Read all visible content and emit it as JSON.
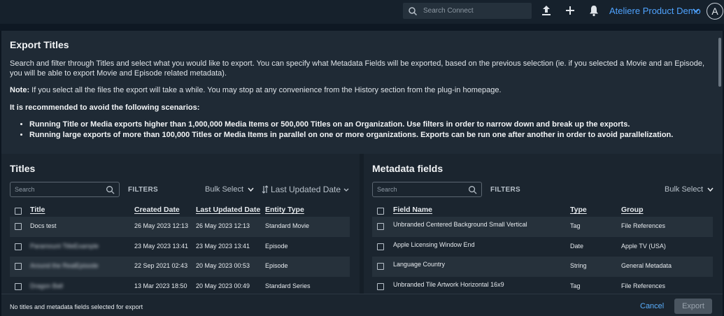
{
  "topbar": {
    "search_placeholder": "Search Connect",
    "org_name": "Ateliere Product Demo",
    "avatar_letter": "A",
    "icons": [
      "upload-icon",
      "plus-icon",
      "bell-icon"
    ]
  },
  "modal": {
    "title": "Export Titles",
    "description": "Search and filter through Titles and select what you would like to export. You can specify what Metadata Fields will be exported, based on the previous selection (ie. if you selected a Movie and an Episode, you will be able to export Movie and Episode related metadata).",
    "note_label": "Note:",
    "note_text": " If you select all the files the export will take a while. You may stop at any convenience from the History section from the plug-in homepage.",
    "recommendation": "It is recommended to avoid the following scenarios:",
    "bullets": [
      "Running Title or Media exports higher than 1,000,000 Media Items or 500,000 Titles on an Organization. Use filters in order to narrow down and break up the exports.",
      "Running large exports of more than 100,000 Titles or Media Items in parallel on one or more organizations. Exports can be run one after another in order to avoid parallelization."
    ]
  },
  "titles_panel": {
    "title": "Titles",
    "search_placeholder": "Search",
    "filters_label": "FILTERS",
    "bulk_select_label": "Bulk Select",
    "sort_label": "Last Updated Date",
    "columns": [
      "Title",
      "Created Date",
      "Last Updated Date",
      "Entity Type"
    ],
    "rows": [
      {
        "title": "Docs test",
        "created": "26 May 2023 12:13",
        "updated": "26 May 2023 12:13",
        "type": "Standard Movie"
      },
      {
        "title": "Paramount TitleExample",
        "created": "23 May 2023 13:41",
        "updated": "23 May 2023 13:41",
        "type": "Episode"
      },
      {
        "title": "Around the RealEpisode",
        "created": "22 Sep 2021 02:43",
        "updated": "20 May 2023 00:53",
        "type": "Episode"
      },
      {
        "title": "Dragon Ball",
        "created": "13 Mar 2023 18:50",
        "updated": "20 May 2023 00:49",
        "type": "Standard Series"
      }
    ]
  },
  "metadata_panel": {
    "title": "Metadata fields",
    "search_placeholder": "Search",
    "filters_label": "FILTERS",
    "bulk_select_label": "Bulk Select",
    "columns": [
      "Field Name",
      "Type",
      "Group"
    ],
    "rows": [
      {
        "name": "Unbranded Centered Background Small Vertical",
        "type": "Tag",
        "group": "File References"
      },
      {
        "name": "Apple Licensing Window End",
        "type": "Date",
        "group": "Apple TV (USA)"
      },
      {
        "name": "Language Country",
        "type": "String",
        "group": "General Metadata"
      },
      {
        "name": "Unbranded Tile Artwork Horizontal 16x9",
        "type": "Tag",
        "group": "File References"
      }
    ]
  },
  "footer": {
    "status": "No titles and metadata fields selected for export",
    "cancel_label": "Cancel",
    "export_label": "Export"
  },
  "colors": {
    "accent": "#4fa3ff",
    "background": "#1b252f",
    "export_disabled": "#4a5560"
  }
}
